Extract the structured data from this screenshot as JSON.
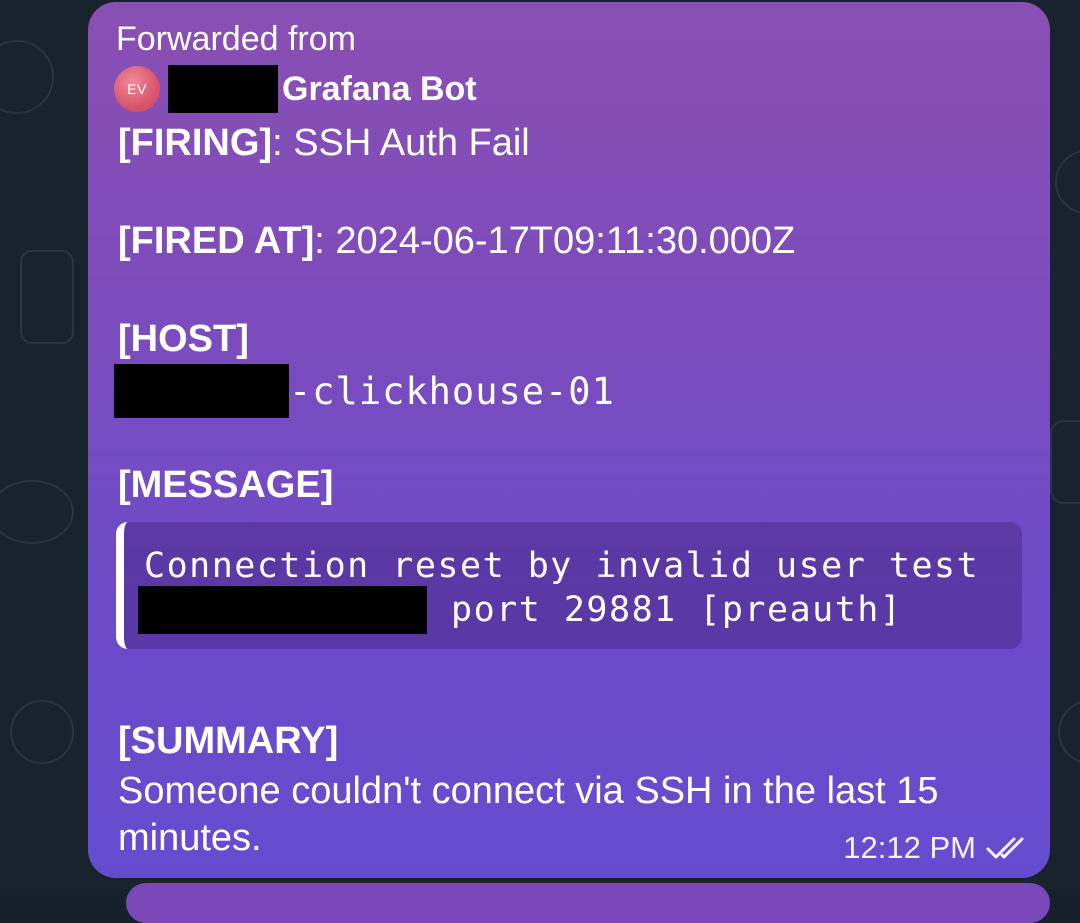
{
  "message": {
    "forwarded_label": "Forwarded from",
    "sender_avatar_initials": "EV",
    "sender_name": "Grafana Bot",
    "firing_label": "[FIRING]",
    "firing_value": ": SSH Auth Fail",
    "fired_at_label": "[FIRED AT]",
    "fired_at_value": ": 2024-06-17T09:11:30.000Z",
    "host_label": "[HOST]",
    "host_suffix": "-clickhouse-01",
    "message_label": "[MESSAGE]",
    "code_line1": "Connection reset by invalid user test",
    "code_line2_suffix": "port 29881 [preauth]",
    "summary_label": "[SUMMARY]",
    "summary_text": "Someone couldn't connect via SSH in the last 15 minutes.",
    "time": "12:12 PM",
    "status_icon": "double-check-icon"
  },
  "colors": {
    "bubble_top": "#8a4fb3",
    "bubble_bottom": "#654ccf",
    "chat_background": "#18232d",
    "avatar": "#d9566d"
  }
}
